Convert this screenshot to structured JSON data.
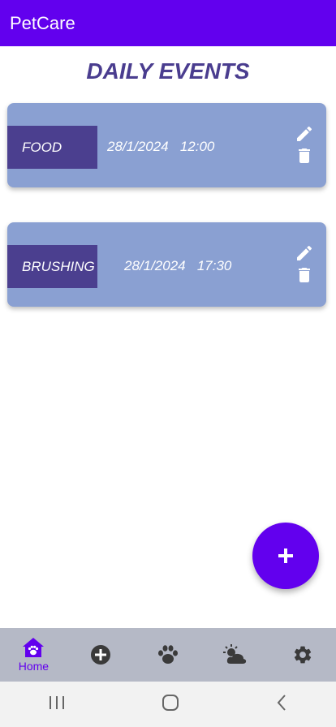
{
  "appbar": {
    "title": "PetCare"
  },
  "page": {
    "title": "DAILY EVENTS"
  },
  "events": [
    {
      "type": "FOOD",
      "date": "28/1/2024",
      "time": "12:00"
    },
    {
      "type": "BRUSHING",
      "date": "28/1/2024",
      "time": "17:30"
    }
  ],
  "fab": {
    "icon": "plus-icon"
  },
  "bottom_nav": {
    "items": [
      {
        "icon": "home-paw-icon",
        "label": "Home",
        "active": true
      },
      {
        "icon": "add-circle-icon"
      },
      {
        "icon": "paw-icon"
      },
      {
        "icon": "weather-icon"
      },
      {
        "icon": "gear-icon"
      }
    ]
  },
  "colors": {
    "primary": "#6200ee",
    "card": "#8aa0d2",
    "tag": "#4b3f8f",
    "title": "#4a3d8f",
    "nav": "#b5b9c6"
  }
}
